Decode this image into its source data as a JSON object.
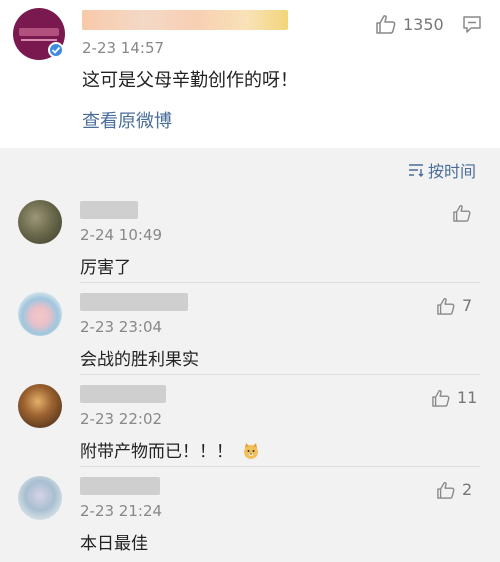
{
  "post": {
    "time": "2-23 14:57",
    "likes": "1350",
    "text": "这可是父母辛勤创作的呀！",
    "link": "查看原微博"
  },
  "sort": {
    "label": "按时间"
  },
  "comments": [
    {
      "time": "2-24 10:49",
      "text": "厉害了",
      "likes": ""
    },
    {
      "time": "2-23 23:04",
      "text": "会战的胜利果实",
      "likes": "7"
    },
    {
      "time": "2-23 22:02",
      "text": "附带产物而已！！！",
      "likes": "11"
    },
    {
      "time": "2-23 21:24",
      "text": "本日最佳",
      "likes": "2"
    }
  ],
  "icons": {
    "like": "thumbs-up-icon",
    "comment": "comment-icon",
    "sort": "sort-lines-icon",
    "verified": "verified-badge-icon",
    "emoji": "doge-emoji-icon"
  },
  "colors": {
    "link": "#4a6d9a",
    "verified": "#3f8ae0"
  }
}
